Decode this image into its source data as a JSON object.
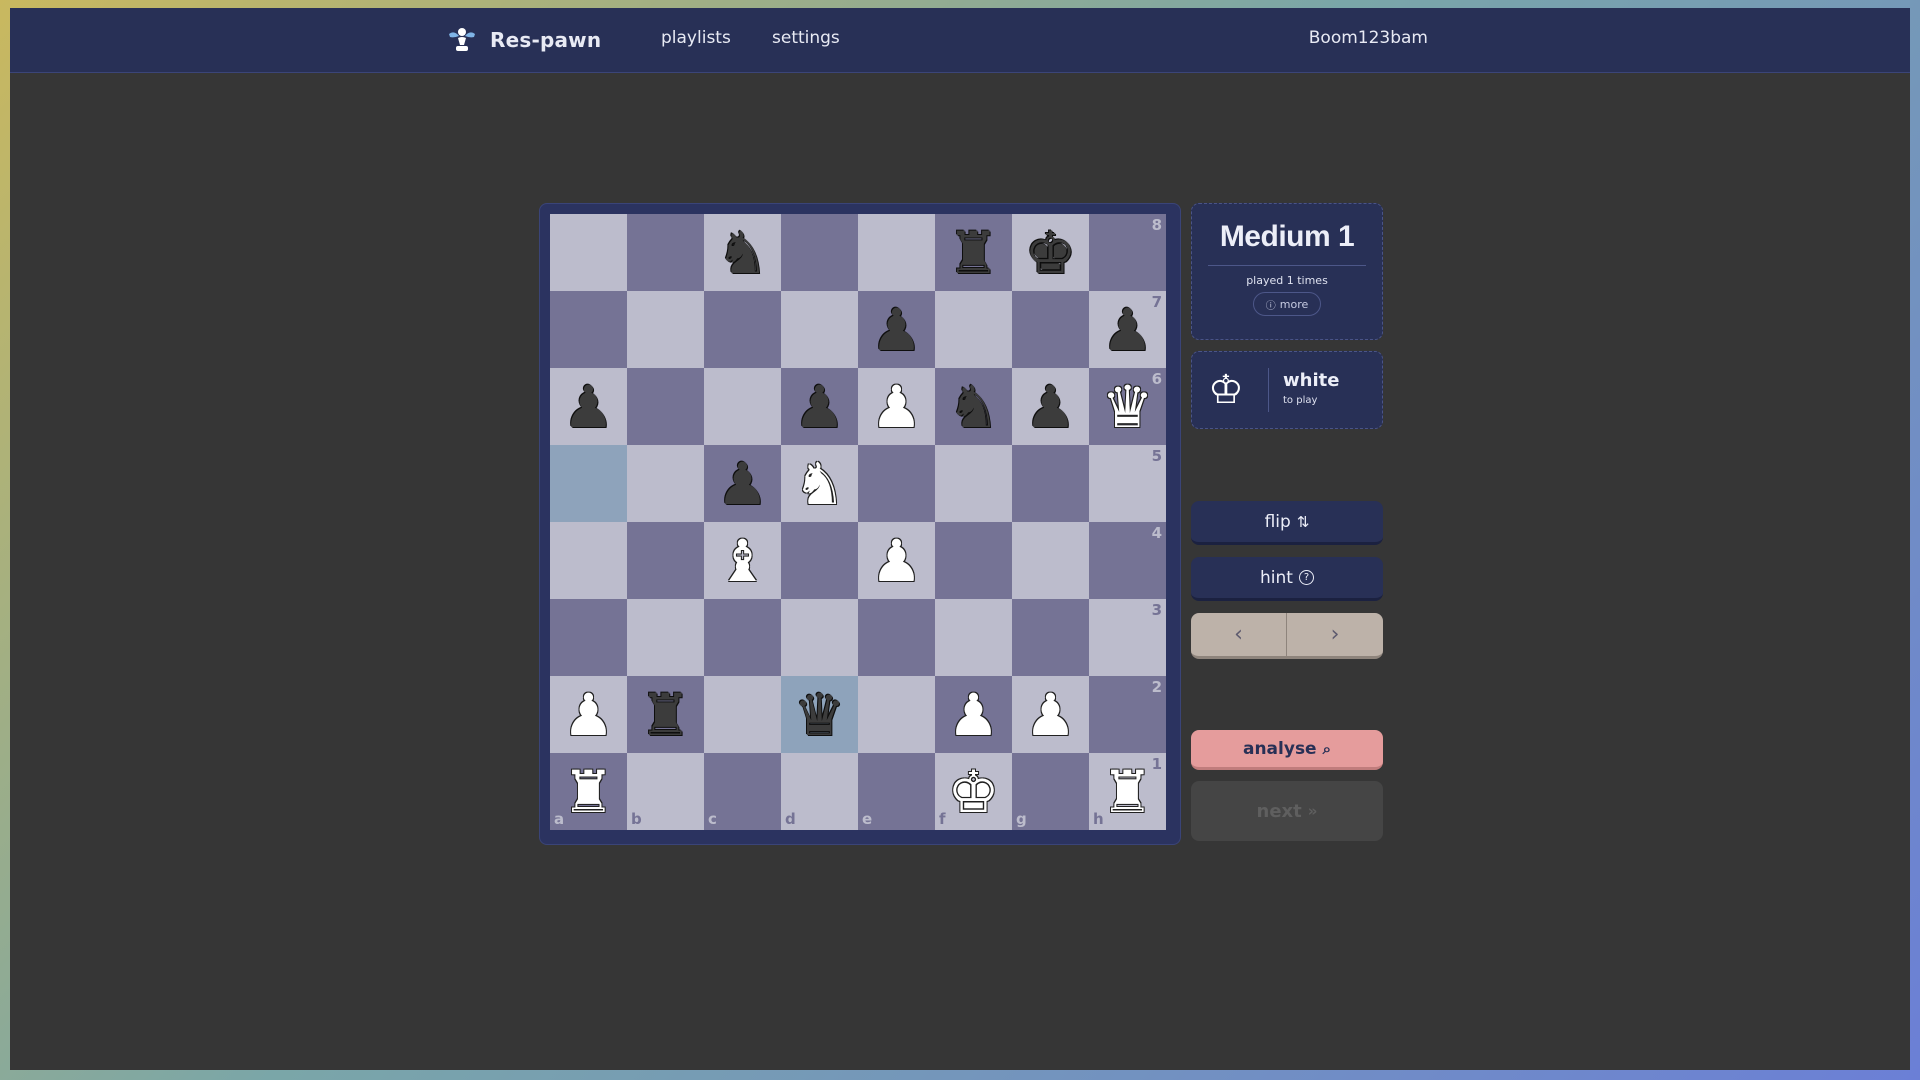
{
  "nav": {
    "brand": "Res-pawn",
    "playlists": "playlists",
    "settings": "settings",
    "username": "Boom123bam",
    "theme_icon": "moon-icon"
  },
  "puzzle": {
    "title": "Medium 1",
    "played": "played 1 times",
    "more_label": "more",
    "more_icon": "info-icon"
  },
  "turn": {
    "side": "white",
    "sub": "to play",
    "icon": "white-king-icon"
  },
  "controls": {
    "flip": "flip",
    "flip_icon": "⇅",
    "hint": "hint",
    "hint_icon": "?",
    "prev": "‹",
    "next": "›",
    "analyse": "analyse",
    "analyse_icon": "⌕",
    "next_puzzle": "next",
    "next_puzzle_icon": "»"
  },
  "board": {
    "files": [
      "a",
      "b",
      "c",
      "d",
      "e",
      "f",
      "g",
      "h"
    ],
    "ranks": [
      "8",
      "7",
      "6",
      "5",
      "4",
      "3",
      "2",
      "1"
    ],
    "colors": {
      "light": "#bcbccc",
      "dark": "#757395",
      "highlight": "#8ea3bb"
    },
    "highlighted": [
      "a5",
      "d2"
    ],
    "position": [
      [
        "",
        "",
        "bN",
        "",
        "",
        "bR",
        "bK",
        ""
      ],
      [
        "",
        "",
        "",
        "",
        "bP",
        "",
        "",
        "bP"
      ],
      [
        "bP",
        "",
        "",
        "bP",
        "wP",
        "bN",
        "bP",
        "wQ"
      ],
      [
        "",
        "",
        "bP",
        "wN",
        "",
        "",
        "",
        ""
      ],
      [
        "",
        "",
        "wB",
        "",
        "wP",
        "",
        "",
        ""
      ],
      [
        "",
        "",
        "",
        "",
        "",
        "",
        "",
        ""
      ],
      [
        "wP",
        "bR",
        "",
        "bQ",
        "",
        "wP",
        "wP",
        ""
      ],
      [
        "wR",
        "",
        "",
        "",
        "",
        "wK",
        "",
        "wR"
      ]
    ]
  }
}
